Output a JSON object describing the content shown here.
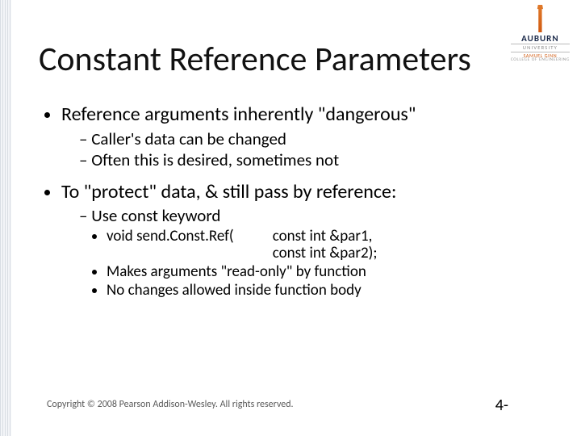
{
  "logo": {
    "university": "AUBURN",
    "line1": "UNIVERSITY",
    "line2": "SAMUEL GINN",
    "line3": "COLLEGE OF ENGINEERING"
  },
  "title": "Constant Reference Parameters",
  "bullets": {
    "b1": "Reference arguments inherently \"dangerous\"",
    "b1_sub": {
      "s1": "Caller's data can be changed",
      "s2": "Often this is desired, sometimes not"
    },
    "b2": "To \"protect\" data, & still pass by reference:",
    "b2_sub": {
      "s1": "Use const keyword",
      "s1_sub": {
        "code_call": "void send.Const.Ref(",
        "code_params": "const int &par1,\nconst int &par2);",
        "c2": "Makes arguments \"read-only\" by function",
        "c3": "No changes allowed inside function body"
      }
    }
  },
  "footer": {
    "copyright": "Copyright © 2008 Pearson Addison-Wesley. All rights reserved.",
    "page": "4-"
  }
}
